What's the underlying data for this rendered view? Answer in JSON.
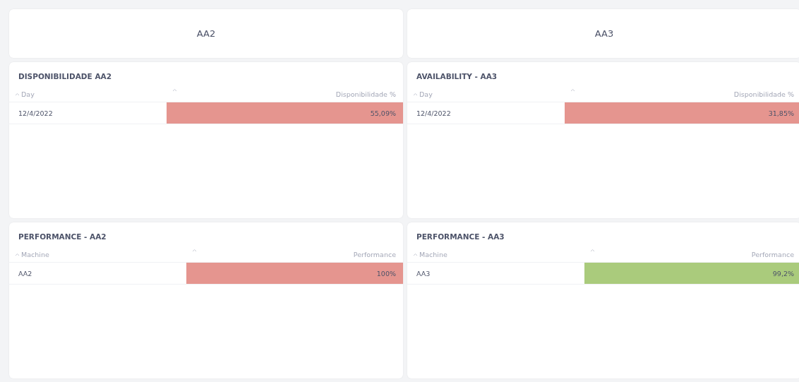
{
  "columns": [
    {
      "header": "AA2",
      "tables": [
        {
          "title": "DISPONIBILIDADE AA2",
          "columns": [
            "Day",
            "Disponibilidade %"
          ],
          "rows": [
            {
              "cells": [
                "12/4/2022",
                "55,09%"
              ],
              "color": "#e5958f"
            }
          ]
        },
        {
          "title": "PERFORMANCE - AA2",
          "columns": [
            "Machine",
            "Performance"
          ],
          "rows": [
            {
              "cells": [
                "AA2",
                "100%"
              ],
              "color": "#e5958f"
            }
          ]
        }
      ]
    },
    {
      "header": "AA3",
      "tables": [
        {
          "title": "AVAILABILITY - AA3",
          "columns": [
            "Day",
            "Disponibilidade %"
          ],
          "rows": [
            {
              "cells": [
                "12/4/2022",
                "31,85%"
              ],
              "color": "#e5958f"
            }
          ]
        },
        {
          "title": "PERFORMANCE - AA3",
          "columns": [
            "Machine",
            "Performance"
          ],
          "rows": [
            {
              "cells": [
                "AA3",
                "99,2%"
              ],
              "color": "#aacb7c"
            }
          ]
        }
      ]
    }
  ]
}
